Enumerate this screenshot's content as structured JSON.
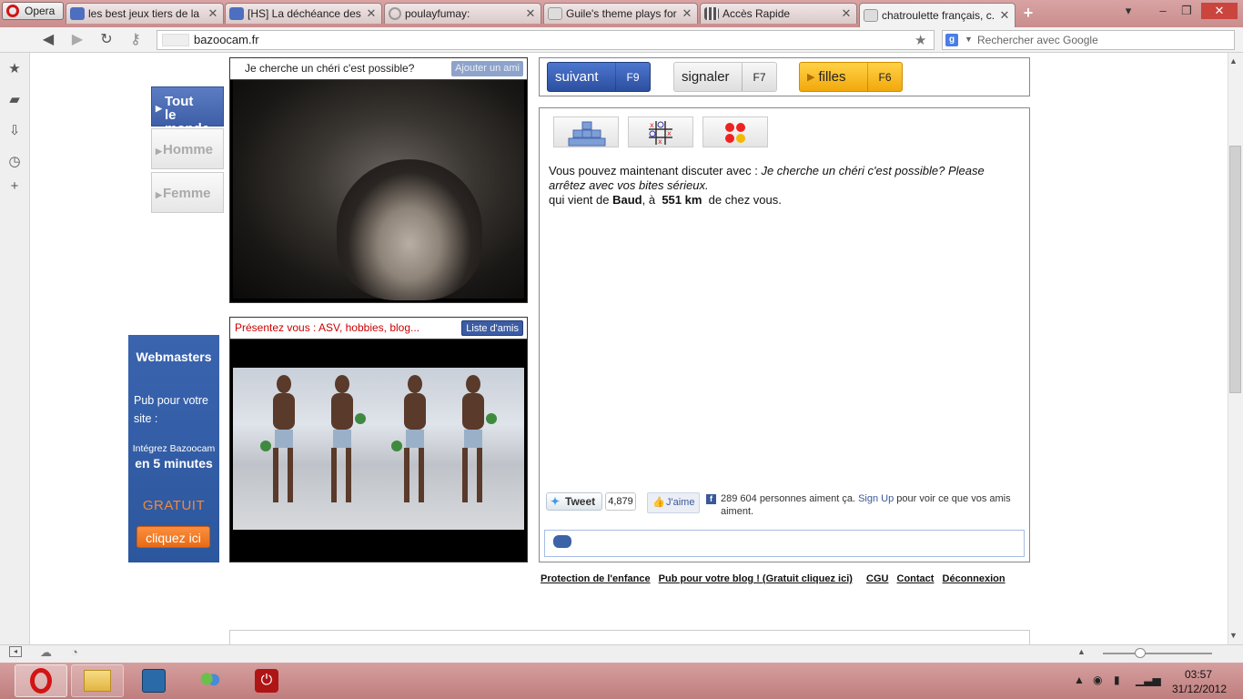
{
  "browser": {
    "menu_label": "Opera",
    "tabs": [
      {
        "title": "les best jeux tiers de la ..."
      },
      {
        "title": "[HS] La déchéance des ..."
      },
      {
        "title": "poulayfumay:"
      },
      {
        "title": "Guile's theme plays for ..."
      },
      {
        "title": "Accès Rapide"
      },
      {
        "title": "chatroulette français, c..."
      }
    ],
    "url": "bazoocam.fr",
    "search_placeholder": "Rechercher avec Google"
  },
  "gender_filter": {
    "selected_line1": "Tout",
    "selected_line2": "le monde",
    "homme": "Homme",
    "femme": "Femme"
  },
  "partner_video": {
    "header": "Je cherche un chéri c'est possible?",
    "add_friend": "Ajouter un ami"
  },
  "my_video": {
    "header": "Présentez vous : ASV, hobbies, blog...",
    "friends_list": "Liste d'amis"
  },
  "ad": {
    "title": "Webmasters",
    "pub_line1": "Pub pour votre",
    "pub_line2": "site :",
    "integrate": "Intégrez Bazoocam",
    "duration": "en 5 minutes",
    "free": "GRATUIT",
    "cta": "cliquez ici"
  },
  "controls": {
    "next_label": "suivant",
    "next_key": "F9",
    "report_label": "signaler",
    "report_key": "F7",
    "girls_label": "filles",
    "girls_key": "F6"
  },
  "chat": {
    "intro": "Vous pouvez maintenant discuter avec :",
    "partner_msg": "Je cherche un chéri c'est possible? Please arrêtez avec vos bites sérieux.",
    "from_prefix": "qui vient de",
    "city": "Baud",
    "sep": ", à",
    "distance": "551 km",
    "from_suffix": "de chez vous."
  },
  "social": {
    "tweet": "Tweet",
    "tweet_count": "4,879",
    "like": "J'aime",
    "fb_count_text": "289 604 personnes aiment ça.",
    "fb_signup": "Sign Up",
    "fb_rest": "pour voir ce que vos amis aiment."
  },
  "footer": {
    "links": [
      "Protection de l'enfance",
      "Pub pour votre blog ! (Gratuit cliquez ici)",
      "CGU",
      "Contact",
      "Déconnexion"
    ]
  },
  "taskbar": {
    "time": "03:57",
    "date": "31/12/2012"
  },
  "colors": {
    "accent_blue": "#3c5da4",
    "orange": "#f2a80c",
    "tabbar": "#c98d8d"
  }
}
